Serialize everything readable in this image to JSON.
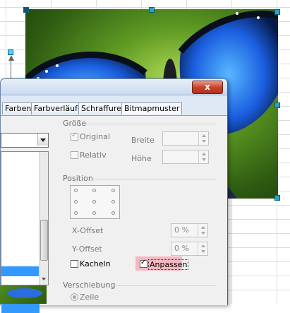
{
  "dialog": {
    "close_label": "x",
    "tabs": [
      "Farben",
      "Farbverläufe",
      "Schraffuren",
      "Bitmapmuster"
    ]
  },
  "groesse": {
    "title": "Größe",
    "original_label": "Original",
    "original_checked": true,
    "relativ_label": "Relativ",
    "relativ_checked": false,
    "breite_label": "Breite",
    "hoehe_label": "Höhe",
    "breite_value": "",
    "hoehe_value": ""
  },
  "position": {
    "title": "Position",
    "x_offset_label": "X-Offset",
    "x_offset_value": "0 %",
    "y_offset_label": "Y-Offset",
    "y_offset_value": "0 %",
    "kacheln_label": "Kacheln",
    "kacheln_checked": false,
    "anpassen_label": "Anpassen",
    "anpassen_checked": true
  },
  "verschiebung": {
    "title": "Verschiebung",
    "zeile_label": "Zeile",
    "zeile_selected": true
  },
  "colors": {
    "highlight": "#f5b8c0",
    "close_button": "#c8432a",
    "list_selection": "#3399ff",
    "handle": "#24a6c8"
  }
}
